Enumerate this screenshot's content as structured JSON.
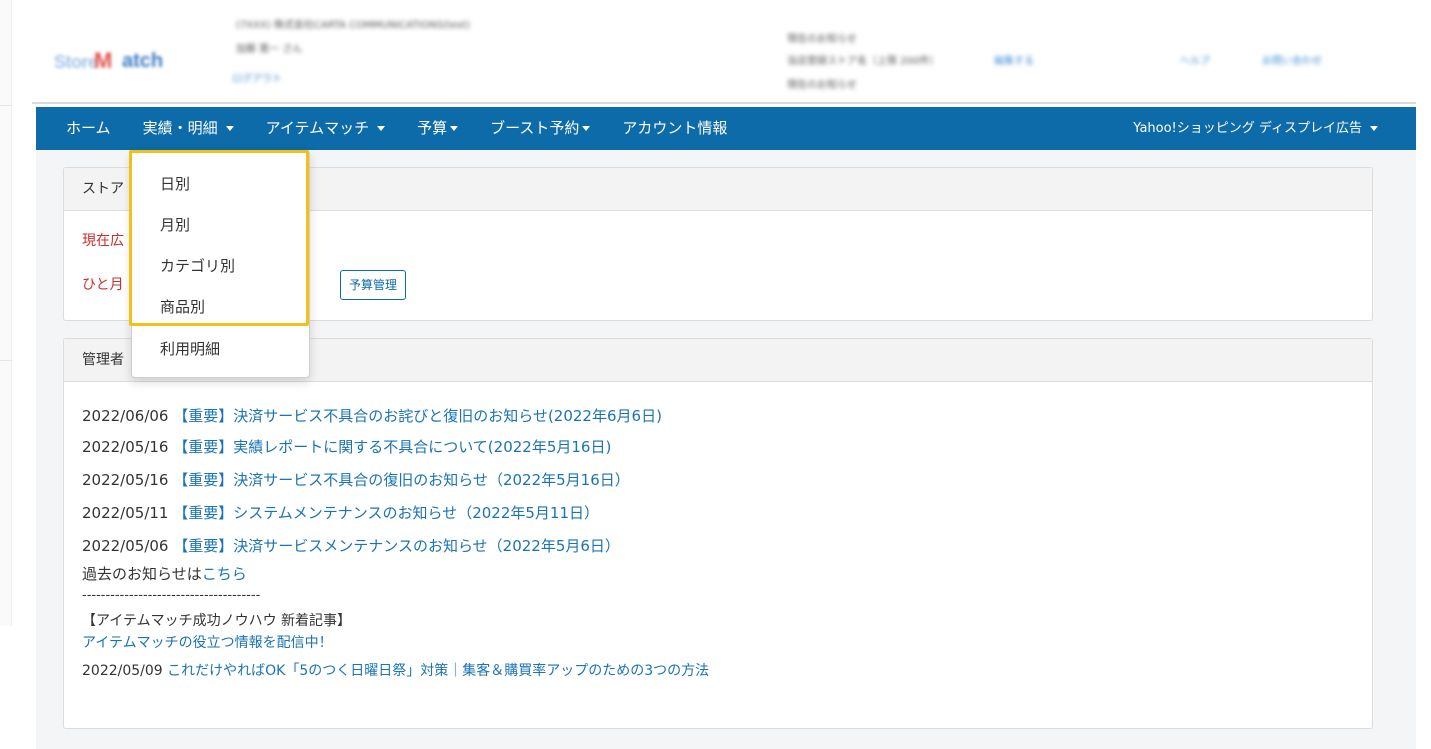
{
  "header": {
    "logo_part1": "Store",
    "logo_part2": "M",
    "logo_part3": "atch",
    "account_line1": "(7XXX) 株式会社CARTA COMMUNICATIONS(test)",
    "account_line2": "加藤 寛一 さん",
    "logout": "ログアウト",
    "store_line1": "現在のお知らせ",
    "store_line2": "当店登録ストア名（上限 200件）",
    "store_edit": "編集する",
    "store_line3": "現在のお知らせ",
    "help": "ヘルプ",
    "contact": "お問い合わせ"
  },
  "navbar": {
    "home": "ホーム",
    "results": "実績・明細",
    "itemmatch": "アイテムマッチ",
    "budget": "予算",
    "boost": "ブースト予約",
    "account": "アカウント情報",
    "right_menu": "Yahoo!ショッピング ディスプレイ広告"
  },
  "dropdown": {
    "items": [
      "日別",
      "月別",
      "カテゴリ別",
      "商品別",
      "利用明細"
    ]
  },
  "card1": {
    "header": "ストア",
    "line1": "現在広",
    "line2": "ひと月",
    "budget_button": "予算管理"
  },
  "card2": {
    "header": "管理者",
    "news": [
      {
        "date": "2022/06/06",
        "title": "【重要】決済サービス不具合のお詫びと復旧のお知らせ(2022年6月6日)"
      },
      {
        "date": "2022/05/16",
        "title": "【重要】実績レポートに関する不具合について(2022年5月16日)"
      },
      {
        "date": "2022/05/16",
        "title": "【重要】決済サービス不具合の復旧のお知らせ（2022年5月16日）"
      },
      {
        "date": "2022/05/11",
        "title": "【重要】システムメンテナンスのお知らせ（2022年5月11日）"
      },
      {
        "date": "2022/05/06",
        "title": "【重要】決済サービスメンテナンスのお知らせ（2022年5月6日）"
      }
    ],
    "past_prefix": "過去のお知らせは",
    "past_link": "こちら",
    "dashes": "--------------------------------------",
    "article_heading": "【アイテムマッチ成功ノウハウ 新着記事】",
    "article_sub": "アイテムマッチの役立つ情報を配信中！",
    "article_date": "2022/05/09",
    "article_title": "これだけやればOK「5のつく日曜日祭」対策｜集客＆購買率アップのための3つの方法"
  },
  "colors": {
    "navbar": "#0c6ba8",
    "link": "#1a73b5",
    "alert_red": "#c9302c",
    "highlight": "#f3c018"
  }
}
